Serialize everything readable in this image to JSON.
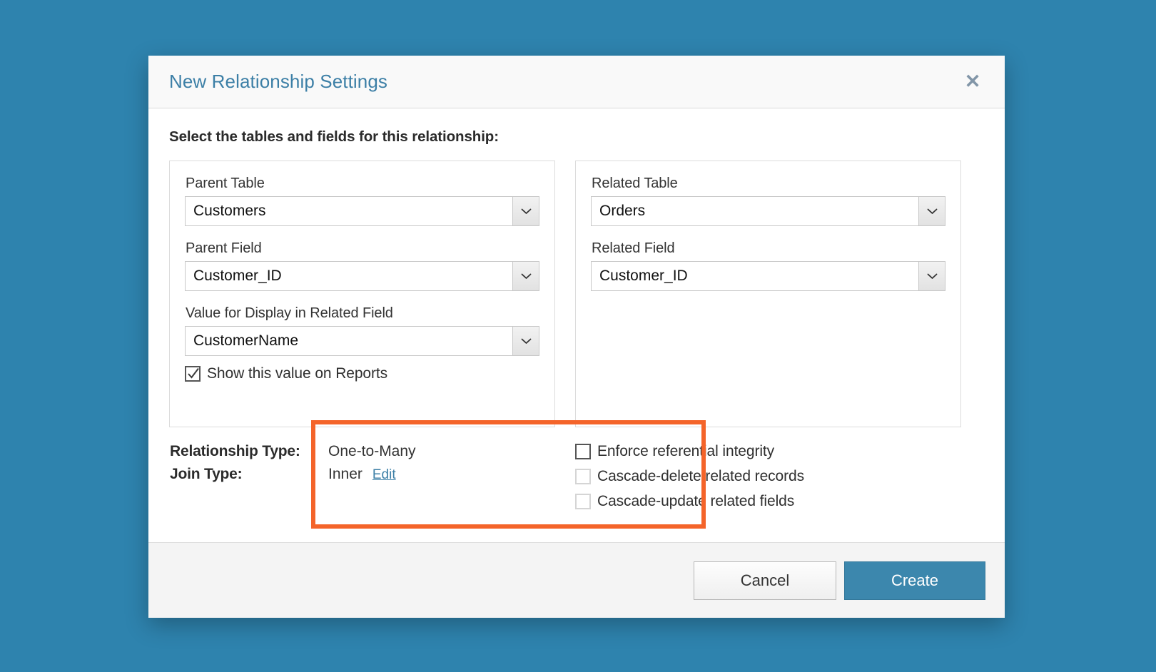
{
  "window": {
    "title": "New Relationship Settings",
    "close_icon": "close-icon",
    "background_color": "#2e83ae",
    "accent_color": "#3c7fa6",
    "highlight_color": "#f4642a"
  },
  "instruction": "Select the tables and fields for this relationship:",
  "parent_panel": {
    "table_label": "Parent Table",
    "table_value": "Customers",
    "field_label": "Parent Field",
    "field_value": "Customer_ID",
    "display_value_label": "Value for Display in Related Field",
    "display_value": "CustomerName",
    "show_on_reports_label": "Show this value on Reports",
    "show_on_reports_checked": true
  },
  "related_panel": {
    "table_label": "Related Table",
    "table_value": "Orders",
    "field_label": "Related Field",
    "field_value": "Customer_ID"
  },
  "summary": {
    "relationship_type_label": "Relationship Type:",
    "relationship_type_value": "One-to-Many",
    "join_type_label": "Join Type:",
    "join_type_value": "Inner",
    "edit_link": "Edit"
  },
  "integrity_options": [
    {
      "label": "Enforce referential integrity",
      "checked": false,
      "enabled": true
    },
    {
      "label": "Cascade-delete related records",
      "checked": false,
      "enabled": false
    },
    {
      "label": "Cascade-update related fields",
      "checked": false,
      "enabled": false
    }
  ],
  "footer": {
    "cancel_label": "Cancel",
    "create_label": "Create"
  }
}
